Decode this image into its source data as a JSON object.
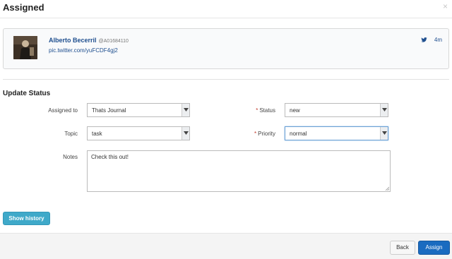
{
  "modal": {
    "title": "Assigned",
    "close_glyph": "×"
  },
  "tweet": {
    "author": "Alberto Becerril",
    "handle": "@A01684110",
    "link": "pic.twitter.com/yuFCDF4gj2",
    "time": "4m",
    "icon": "twitter-bird-icon"
  },
  "form": {
    "section_title": "Update Status",
    "assigned_to": {
      "label": "Assigned to",
      "value": "Thats Journal"
    },
    "status": {
      "label": "Status",
      "value": "new",
      "required": true
    },
    "topic": {
      "label": "Topic",
      "value": "task"
    },
    "priority": {
      "label": "Priority",
      "value": "normal",
      "required": true
    },
    "notes": {
      "label": "Notes",
      "value": "Check this out!"
    },
    "required_marker": "*"
  },
  "buttons": {
    "show_history": "Show history",
    "back": "Back",
    "assign": "Assign"
  },
  "colors": {
    "primary": "#1a6bc0",
    "info": "#3fa9c9",
    "link": "#1f4f8f",
    "required": "#c0392b"
  }
}
